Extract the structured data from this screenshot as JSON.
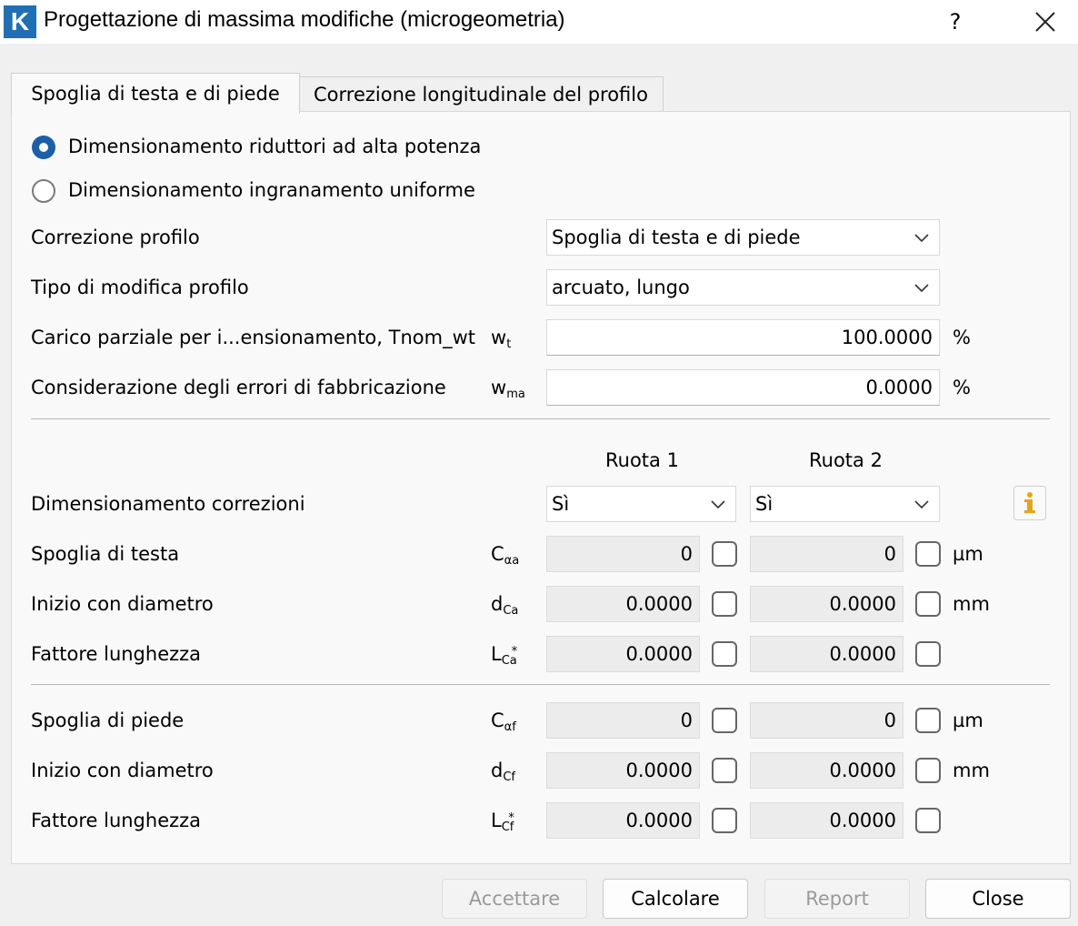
{
  "window": {
    "title": "Progettazione di massima modifiche (microgeometria)",
    "help": "?",
    "logo": "K"
  },
  "tabs": [
    {
      "label": "Spoglia di testa e di piede",
      "active": true
    },
    {
      "label": "Correzione longitudinale del profilo",
      "active": false
    }
  ],
  "radios": [
    {
      "label": "Dimensionamento riduttori ad alta potenza",
      "checked": true
    },
    {
      "label": "Dimensionamento ingranamento uniforme",
      "checked": false
    }
  ],
  "fields": {
    "correzione_profilo": {
      "label": "Correzione profilo",
      "value": "Spoglia di testa e di piede"
    },
    "tipo_modifica": {
      "label": "Tipo di modifica profilo",
      "value": "arcuato, lungo"
    },
    "carico_parziale": {
      "label": "Carico parziale per i...ensionamento, Tnom_wt",
      "symbol": "w",
      "sub": "t",
      "value": "100.0000",
      "unit": "%"
    },
    "errori_fabbricazione": {
      "label": "Considerazione degli errori di fabbricazione",
      "symbol": "w",
      "sub": "ma",
      "value": "0.0000",
      "unit": "%"
    }
  },
  "columns": {
    "ruota1": "Ruota 1",
    "ruota2": "Ruota 2"
  },
  "dimensionamento": {
    "label": "Dimensionamento correzioni",
    "ruota1": "Sì",
    "ruota2": "Sì"
  },
  "rows": [
    {
      "label": "Spoglia di testa",
      "symbol": "C",
      "sub": "αa",
      "sup": "",
      "v1": "0",
      "v2": "0",
      "unit": "µm"
    },
    {
      "label": "Inizio con diametro",
      "symbol": "d",
      "sub": "Ca",
      "sup": "",
      "v1": "0.0000",
      "v2": "0.0000",
      "unit": "mm"
    },
    {
      "label": "Fattore lunghezza",
      "symbol": "L",
      "sub": "Ca",
      "sup": "*",
      "v1": "0.0000",
      "v2": "0.0000",
      "unit": ""
    },
    {
      "label": "Spoglia di piede",
      "symbol": "C",
      "sub": "αf",
      "sup": "",
      "v1": "0",
      "v2": "0",
      "unit": "µm"
    },
    {
      "label": "Inizio con diametro",
      "symbol": "d",
      "sub": "Cf",
      "sup": "",
      "v1": "0.0000",
      "v2": "0.0000",
      "unit": "mm"
    },
    {
      "label": "Fattore lunghezza",
      "symbol": "L",
      "sub": "Cf",
      "sup": "*",
      "v1": "0.0000",
      "v2": "0.0000",
      "unit": ""
    }
  ],
  "buttons": {
    "accept": "Accettare",
    "calculate": "Calcolare",
    "report": "Report",
    "close": "Close"
  },
  "icons": {
    "info": "info-icon",
    "info_color": "#e8a317",
    "accent": "#1c5fa8"
  }
}
